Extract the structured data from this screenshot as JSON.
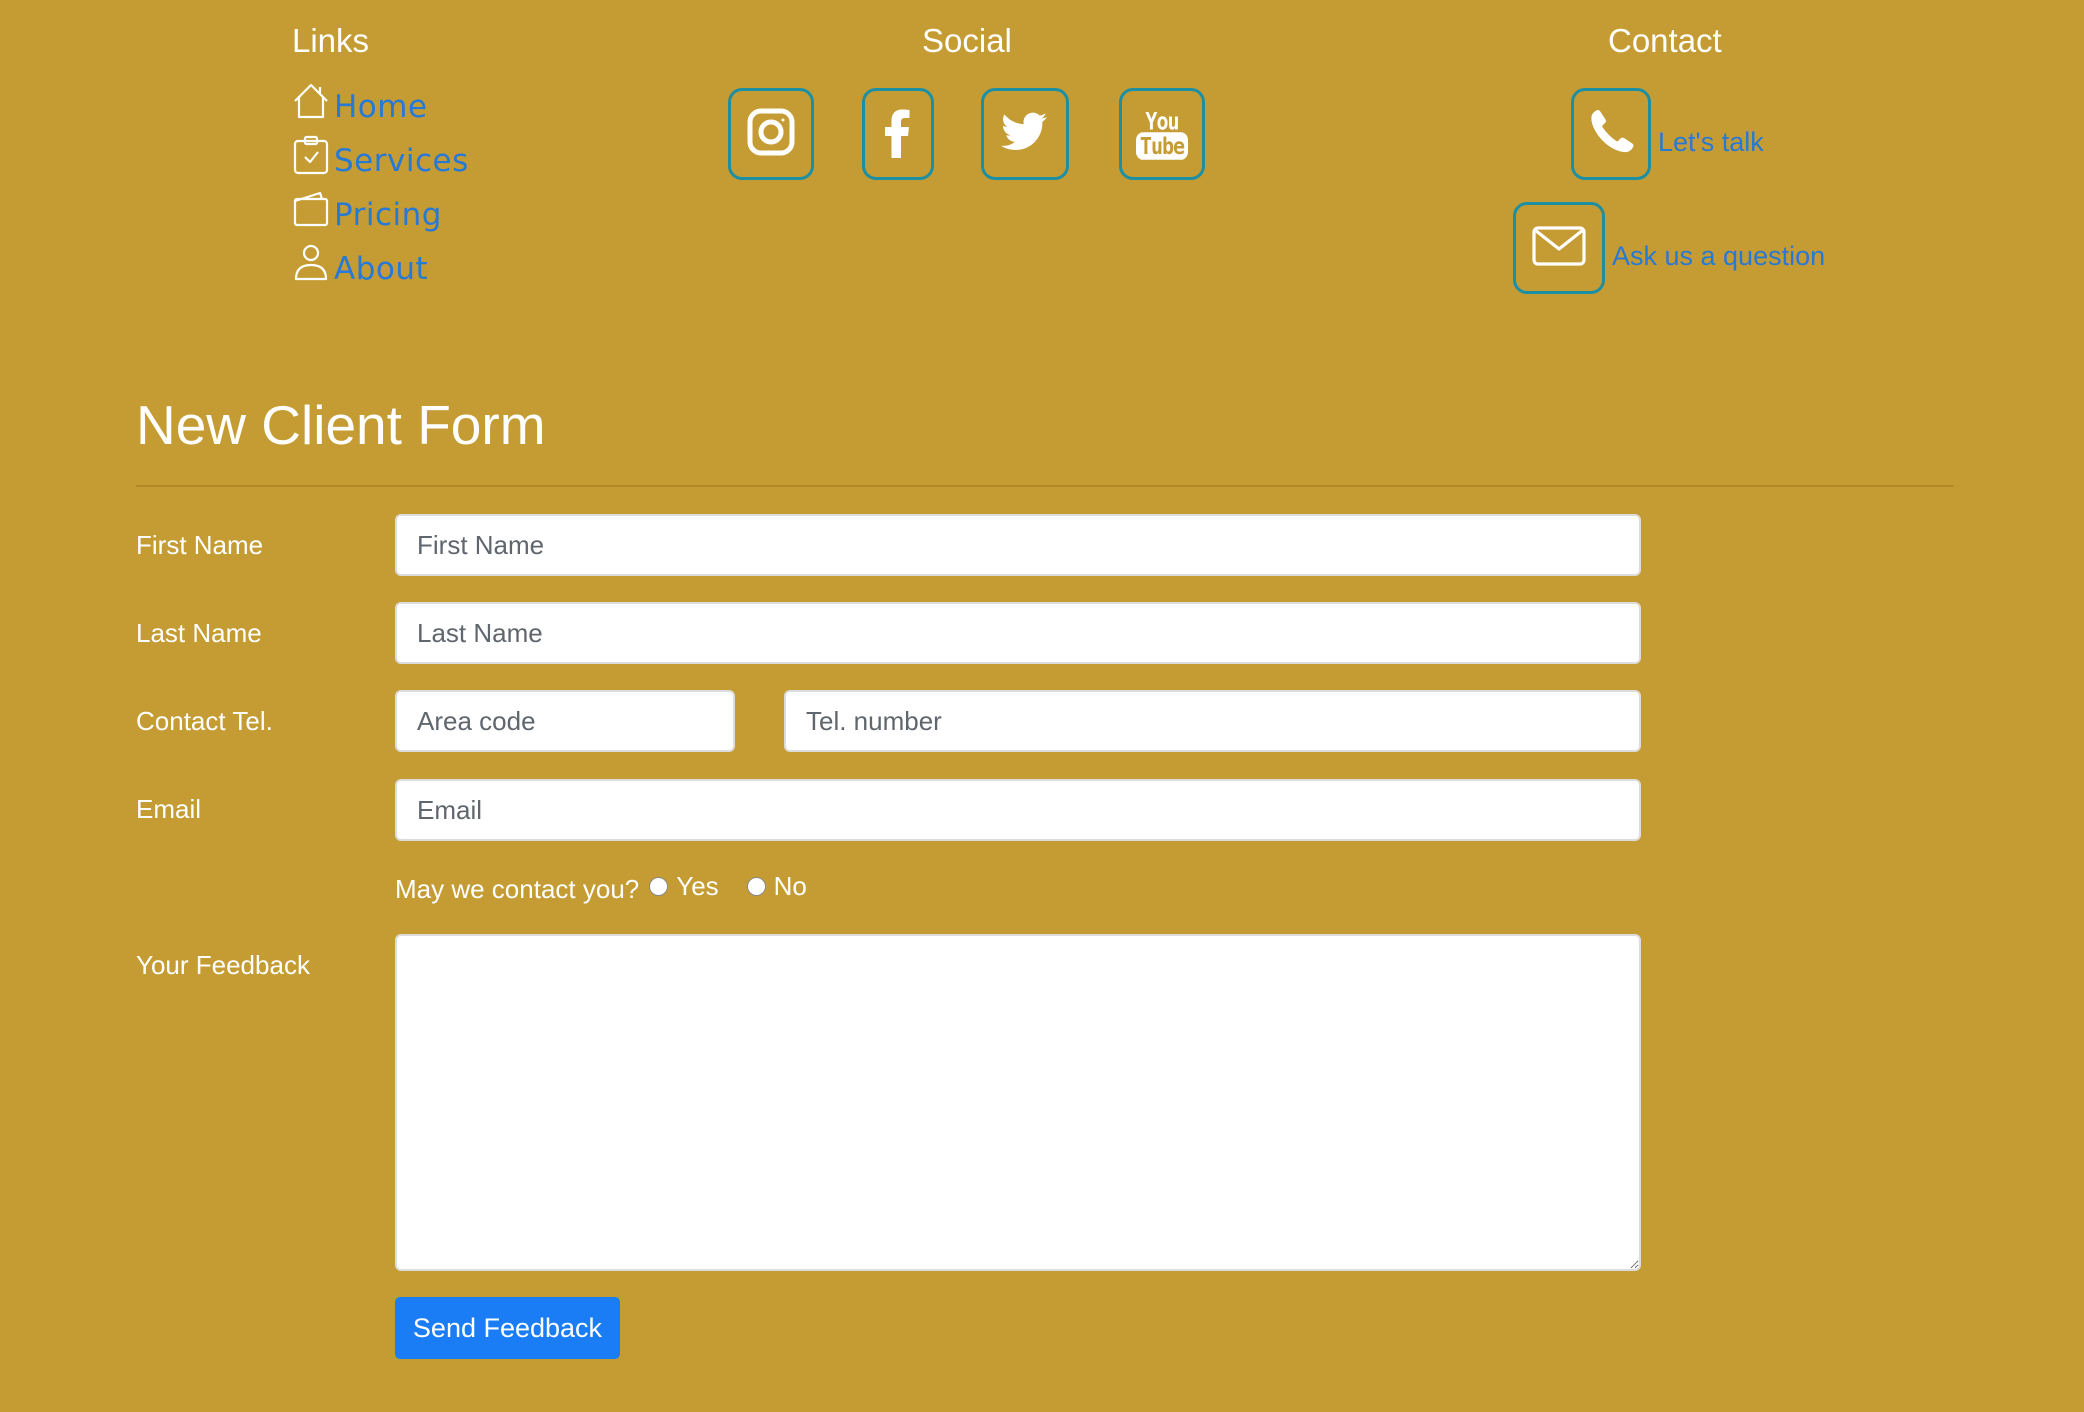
{
  "links": {
    "title": "Links",
    "items": [
      {
        "label": "Home",
        "icon": "house-icon"
      },
      {
        "label": "Services",
        "icon": "clipboard-check-icon"
      },
      {
        "label": "Pricing",
        "icon": "wallet-icon"
      },
      {
        "label": "About",
        "icon": "person-icon"
      }
    ]
  },
  "social": {
    "title": "Social",
    "items": [
      {
        "icon": "instagram-icon"
      },
      {
        "icon": "facebook-icon"
      },
      {
        "icon": "twitter-icon"
      },
      {
        "icon": "youtube-icon",
        "text_top": "You",
        "text_bottom": "Tube"
      }
    ]
  },
  "contact": {
    "title": "Contact",
    "phone_label": "Let's talk",
    "email_label": "Ask us a question",
    "icons": [
      "phone-icon",
      "envelope-icon"
    ]
  },
  "form": {
    "title": "New Client Form",
    "first_name": {
      "label": "First Name",
      "placeholder": "First Name",
      "value": ""
    },
    "last_name": {
      "label": "Last Name",
      "placeholder": "Last Name",
      "value": ""
    },
    "contact_tel": {
      "label": "Contact Tel.",
      "area_placeholder": "Area code",
      "number_placeholder": "Tel. number"
    },
    "email": {
      "label": "Email",
      "placeholder": "Email",
      "value": ""
    },
    "consent": {
      "question": "May we contact you?",
      "yes": "Yes",
      "no": "No"
    },
    "feedback": {
      "label": "Your Feedback",
      "value": ""
    },
    "submit_label": "Send Feedback"
  },
  "colors": {
    "background": "#c49c33",
    "link": "#2779d6",
    "icon_border": "#1d8fa3",
    "button": "#1a7df5"
  }
}
